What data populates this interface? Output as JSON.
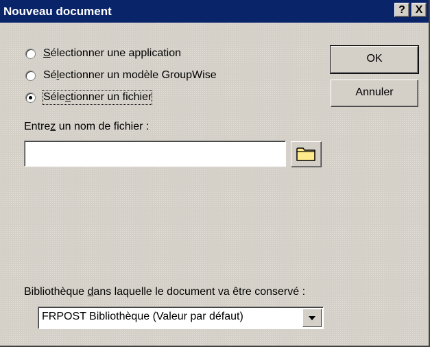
{
  "window": {
    "title": "Nouveau document",
    "help_button": "?",
    "close_button": "X"
  },
  "options": {
    "selected": "file",
    "items": [
      {
        "id": "application",
        "prefix": "",
        "accel": "S",
        "rest": "électionner une application"
      },
      {
        "id": "template",
        "prefix": "Sé",
        "accel": "l",
        "rest": "ectionner un modèle GroupWise"
      },
      {
        "id": "file",
        "prefix": "Séle",
        "accel": "c",
        "rest": "tionner un fichier"
      }
    ]
  },
  "buttons": {
    "ok": "OK",
    "cancel": "Annuler"
  },
  "filename": {
    "label_prefix": "Entre",
    "label_accel": "z",
    "label_rest": " un nom de fichier :",
    "value": "",
    "browse_icon": "folder-icon"
  },
  "library": {
    "label_prefix": "Bibliothèque ",
    "label_accel": "d",
    "label_rest": "ans laquelle le document va être conservé :",
    "selected_value": "FRPOST Bibliothèque  (Valeur par défaut)",
    "dropdown_icon": "chevron-down-icon"
  },
  "colors": {
    "titlebar": "#0a246a",
    "dialog_background": "#d4d0c8",
    "folder_icon": "#ffe98a"
  }
}
